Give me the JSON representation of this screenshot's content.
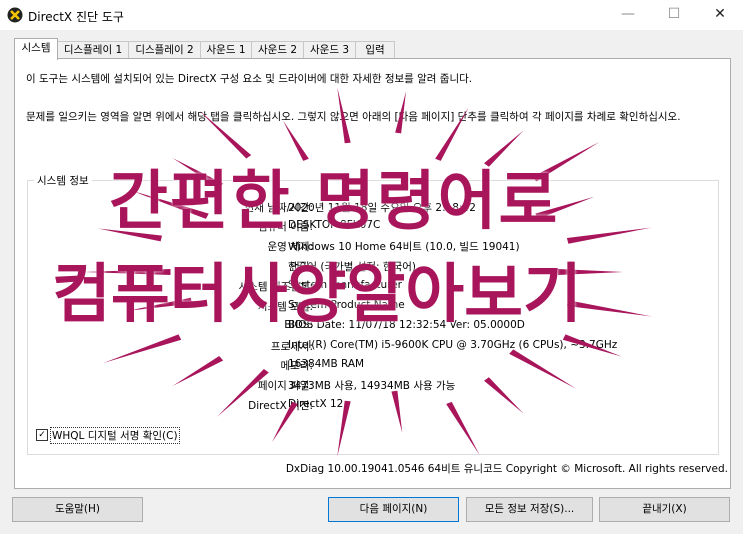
{
  "window": {
    "title": "DirectX 진단 도구",
    "minimize": "—",
    "maximize": "☐",
    "close": "✕"
  },
  "tabs": [
    "시스템",
    "디스플레이 1",
    "디스플레이 2",
    "사운드 1",
    "사운드 2",
    "사운드 3",
    "입력"
  ],
  "intro": "이 도구는 시스템에 설치되어 있는 DirectX 구성 요소 및 드라이버에 대한 자세한 정보를 알려 줍니다.",
  "instructions": "문제를 일으키는 영역을 알면 위에서 해당 탭을 클릭하십시오. 그렇지 않으면 아래의 [다음 페이지] 단추를 클릭하여 각 페이지를 차례로 확인하십시오.",
  "system_info": {
    "label": "시스템 정보",
    "rows": [
      {
        "label": "현재 날짜/시간:",
        "value": "2020년 11월 18일 수요일 오후 2:18:42"
      },
      {
        "label": "컴퓨터 이름:",
        "value": "DESKTOP-8FK07C"
      },
      {
        "label": "운영 체제:",
        "value": "Windows 10 Home 64비트 (10.0, 빌드 19041)"
      },
      {
        "label": "언어:",
        "value": "한국어 (국가별 설정: 한국어)"
      },
      {
        "label": "시스템 제조업체:",
        "value": "System manufacturer"
      },
      {
        "label": "시스템 모델:",
        "value": "System Product Name"
      },
      {
        "label": "BIOS:",
        "value": "BIOS Date: 11/07/18 12:32:54 Ver: 05.0000D"
      },
      {
        "label": "프로세서:",
        "value": "Intel(R) Core(TM) i5-9600K CPU @ 3.70GHz (6 CPUs), ~3.7GHz"
      },
      {
        "label": "메모리:",
        "value": "16384MB RAM"
      },
      {
        "label": "페이지 파일:",
        "value": "3473MB 사용, 14934MB 사용 가능"
      },
      {
        "label": "DirectX 버전:",
        "value": "DirectX 12"
      }
    ]
  },
  "whql_checkbox": {
    "label": "WHQL 디지털 서명 확인(C)",
    "checked": true,
    "mark": "✓"
  },
  "footer_text": "DxDiag 10.00.19041.0546 64비트 유니코드  Copyright © Microsoft. All rights reserved.",
  "buttons": {
    "help": "도움말(H)",
    "next_page": "다음 페이지(N)",
    "save_all": "모든 정보 저장(S)...",
    "exit": "끝내기(X)"
  },
  "overlay": {
    "line1": "간편한 명령어로",
    "line2": "컴퓨터사양알아보기",
    "color": "#a8155b"
  }
}
